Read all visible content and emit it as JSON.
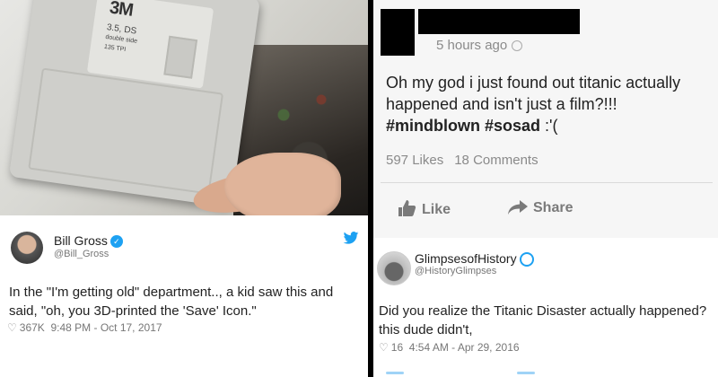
{
  "left": {
    "photo": {
      "disk_brand": "3M",
      "disk_caption": "3.5, DS",
      "disk_caption_2": "double side",
      "disk_caption_3": "135 TPI"
    },
    "tweet": {
      "name": "Bill Gross",
      "handle": "@Bill_Gross",
      "text": "In the \"I'm getting old\" department.., a kid saw this and said, \"oh, you 3D-printed the 'Save' Icon.\"",
      "likes": "367K",
      "time": "9:48 PM - Oct 17, 2017"
    }
  },
  "right": {
    "facebook": {
      "time": "5 hours ago",
      "text": "Oh my god i just found out titanic actually happened and isn't just a film?!!! ",
      "hashtags": "#mindblown #sosad",
      "emoticon": " :'(",
      "likes": "597 Likes",
      "comments": "18 Comments",
      "like_label": "Like",
      "share_label": "Share"
    },
    "tweet": {
      "name": "GlimpsesofHistory",
      "handle": "@HistoryGlimpses",
      "text": "Did you realize the Titanic Disaster actually happened? this dude didn't,",
      "likes": "16",
      "time": "4:54 AM - Apr 29, 2016"
    }
  },
  "colors": {
    "twitter_blue": "#1da1f2",
    "fb_gray": "#7a7a7a"
  }
}
